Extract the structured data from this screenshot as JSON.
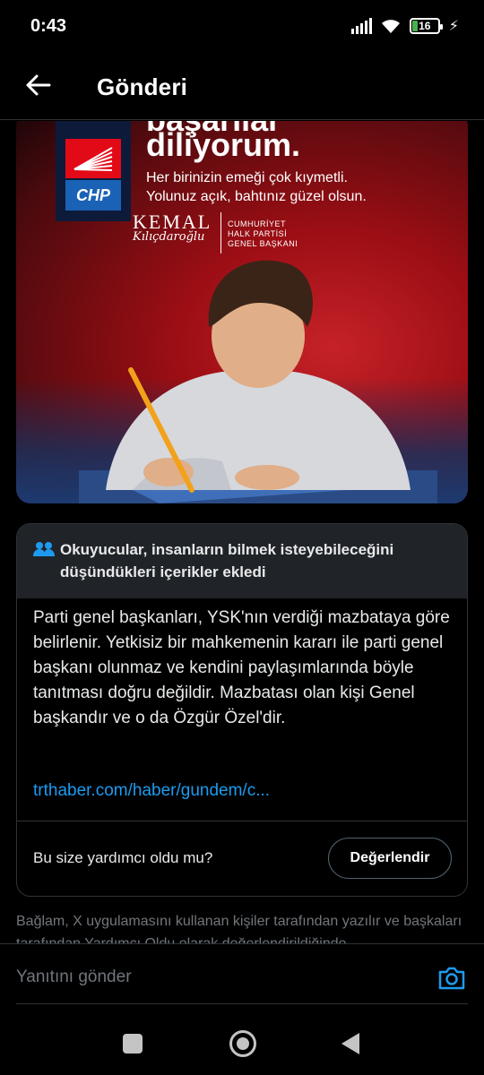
{
  "status_bar": {
    "time": "0:43",
    "battery": "16",
    "icons": [
      "signal-icon",
      "wifi-icon",
      "battery-icon",
      "charging-icon"
    ]
  },
  "header": {
    "title": "Gönderi",
    "back_icon": "arrow-left-icon"
  },
  "poster": {
    "headline_top": "başarılar",
    "headline": "diliyorum.",
    "subtitle_line1": "Her birinizin emeği çok kıymetli.",
    "subtitle_line2": "Yolunuz açık, bahtınız güzel olsun.",
    "logo_text": "CHP",
    "signature_name": "KEMAL",
    "signature_surname": "Kılıçdaroğlu",
    "role_line1": "CUMHURİYET",
    "role_line2": "HALK PARTİSİ",
    "role_line3": "GENEL BAŞKANI",
    "colors": {
      "background": "#c52228",
      "logo_red": "#e30a17",
      "logo_blue": "#1a62b5"
    }
  },
  "community_note": {
    "header": "Okuyucular, insanların bilmek isteyebileceğini düşündükleri içerikler ekledi",
    "body": "Parti genel başkanları, YSK'nın verdiği mazbataya göre belirlenir. Yetkisiz bir mahkemenin kararı ile parti genel başkanı olunmaz ve kendini paylaşımlarında böyle tanıtması doğru değildir. Mazbatası olan kişi Genel başkandır ve o da Özgür Özel'dir.",
    "link": "trthaber.com/haber/gundem/c...",
    "question": "Bu size yardımcı oldu mu?",
    "rate_button": "Değerlendir"
  },
  "footer": {
    "text": "Bağlam, X uygulamasını kullanan kişiler tarafından yazılır ve başkaları tarafından Yardımcı Oldu olarak değerlendirildiğinde"
  },
  "reply": {
    "placeholder": "Yanıtını gönder",
    "camera_icon": "camera-icon",
    "accent": "#1d9bf0"
  },
  "nav": {
    "icons": [
      "recents-icon",
      "home-icon",
      "back-icon"
    ]
  }
}
